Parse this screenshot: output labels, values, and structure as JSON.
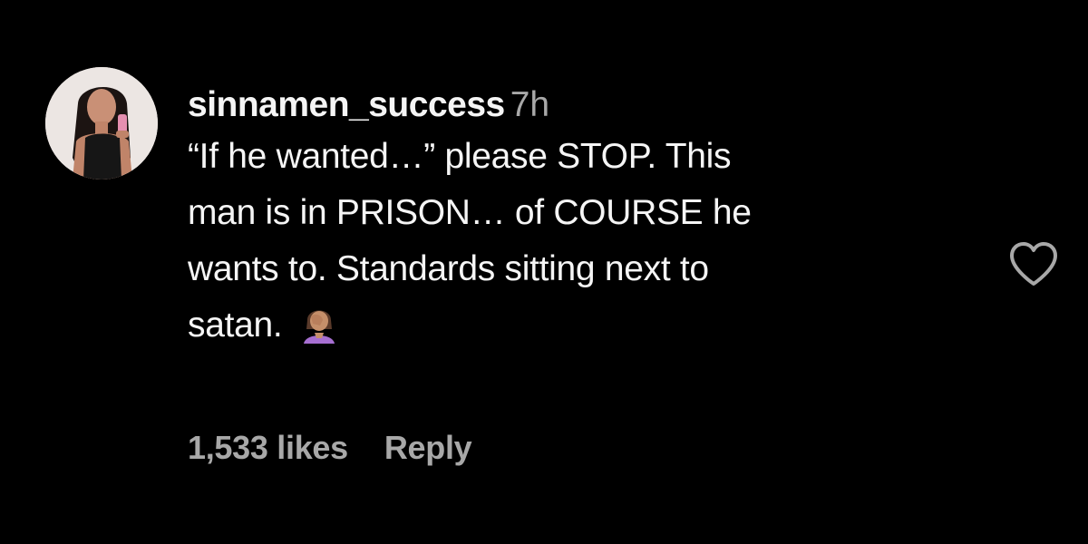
{
  "comment": {
    "avatar_icon": "profile-photo-avatar",
    "username": "sinnamen_success",
    "timestamp": "7h",
    "text_lines": [
      "“If he wanted…” please STOP. This",
      "man is in PRISON… of COURSE he",
      "wants to. Standards sitting next to",
      "satan."
    ],
    "emoji": "🤦🏽‍♀️",
    "likes": "1,533 likes",
    "reply_label": "Reply",
    "like_icon": "heart-outline-icon"
  },
  "colors": {
    "background": "#000000",
    "primary_text": "#f5f5f5",
    "secondary_text": "#a8a8a8",
    "heart_outline": "#a8a8a8"
  }
}
